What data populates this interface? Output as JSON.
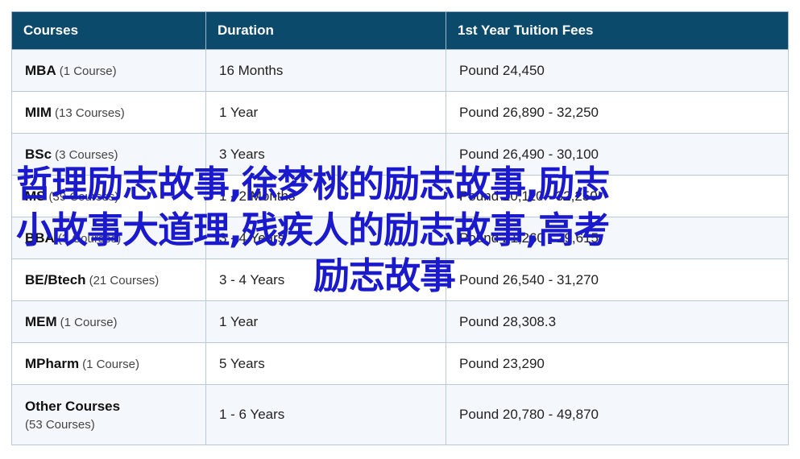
{
  "table": {
    "headers": [
      "Courses",
      "Duration",
      "1st Year Tuition Fees"
    ],
    "rows": [
      {
        "name": "MBA",
        "count": "(1 Course)",
        "duration": "16 Months",
        "fee": "Pound 24,450"
      },
      {
        "name": "MIM",
        "count": "(13 Courses)",
        "duration": "1 Year",
        "fee": "Pound 26,890 - 32,250"
      },
      {
        "name": "BSc",
        "count": "(3 Courses)",
        "duration": "3 Years",
        "fee": "Pound 26,490 - 30,100"
      },
      {
        "name": "MS",
        "count": "(39 Courses)",
        "duration": "1 - 2 Months",
        "fee": "Pound 20,110 - 32,250"
      },
      {
        "name": "BBA",
        "count": "(3 Courses)",
        "duration": "3 - 4 Years",
        "fee": "Pound 21,260 - 29,615"
      },
      {
        "name": "BE/Btech",
        "count": "(21 Courses)",
        "duration": "3 - 4 Years",
        "fee": "Pound 26,540 - 31,270"
      },
      {
        "name": "MEM",
        "count": "(1 Course)",
        "duration": "1 Year",
        "fee": "Pound 28,308.3"
      },
      {
        "name": "MPharm",
        "count": "(1 Course)",
        "duration": "5 Years",
        "fee": "Pound 23,290"
      },
      {
        "name": "Other Courses",
        "count": "(53 Courses)",
        "duration": "1 - 6 Years",
        "fee": "Pound 20,780 - 49,870"
      }
    ]
  },
  "overlay": {
    "line1": "哲理励志故事,徐梦桃的励志故事,励志",
    "line2": "小故事大道理,残疾人的励志故事,高考",
    "line3": "励志故事",
    "color": "#1a1acc"
  },
  "colors": {
    "header_bg": "#0c4a6b",
    "row_alt_bg": "#f4f8fc",
    "border": "#b7cad6"
  }
}
